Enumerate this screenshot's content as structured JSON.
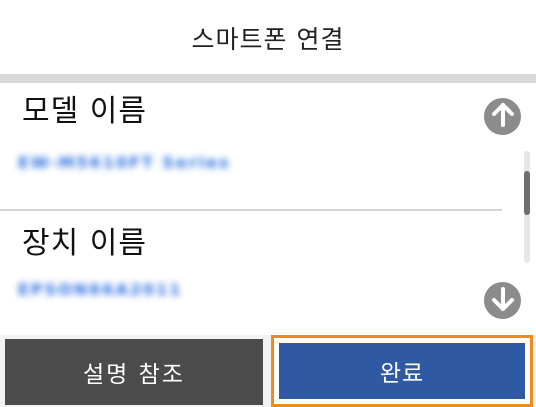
{
  "header": {
    "title": "스마트폰 연결"
  },
  "fields": [
    {
      "label": "모델 이름",
      "value": "EW-M5610FT Series"
    },
    {
      "label": "장치 이름",
      "value": "EPSON66A2011"
    }
  ],
  "scroll": {
    "up_icon": "arrow-up-icon",
    "down_icon": "arrow-down-icon",
    "position": 0.3
  },
  "footer": {
    "help_label": "설명 참조",
    "done_label": "완료"
  },
  "colors": {
    "done_button": "#2f5aa3",
    "help_button": "#4b4b4b",
    "focus_outline": "#ef8a1f",
    "value_text": "#2a6fe0"
  }
}
